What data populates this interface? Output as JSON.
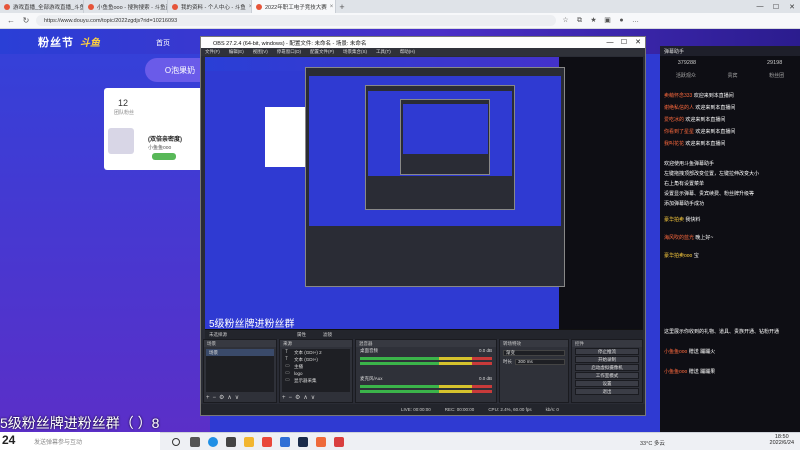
{
  "browser": {
    "tabs": [
      {
        "label": "游戏直播_全部游戏直播_斗鱼直..."
      },
      {
        "label": "小鱼鱼ooo - 搜狗搜索 - 斗鱼直..."
      },
      {
        "label": "我的资料 - 个人中心 - 斗鱼"
      },
      {
        "label": "2022年职工电子竞技大赛"
      }
    ],
    "url": "https://www.douyu.com/topic/2022zgdjs?rid=10216093",
    "new_tab": "+",
    "controls": {
      "min": "—",
      "max": "☐",
      "close": "✕"
    }
  },
  "douyu": {
    "logo": "粉丝节",
    "logo_badge": "斗鱼",
    "nav_home": "首页",
    "banner": "O泡果奶",
    "card": {
      "count": "12",
      "count_label": "团队粉丝",
      "name": "(双倍亲密度)",
      "account": "小鱼鱼ooo"
    }
  },
  "chat": {
    "header": "弹幕助手",
    "stats": [
      "379288",
      "",
      "29198"
    ],
    "tabs": [
      "活跃观众",
      "贵宾",
      "粉丝团"
    ],
    "lines": [
      {
        "user": "卖萌怀念333",
        "text": "欢迎来到本直播间"
      },
      {
        "user": "谢绝私信的人",
        "text": "欢迎来到本直播间"
      },
      {
        "user": "爱吃冰的",
        "text": "欢迎来到本直播间"
      },
      {
        "user": "你看到了星星",
        "text": "欢迎来到本直播间"
      },
      {
        "user": "我叫花花",
        "text": "欢迎来到本直播间"
      },
      {
        "user": "",
        "text": "欢迎使用斗鱼弹幕助手"
      },
      {
        "user": "",
        "text": "左键拖拽顶部改变位置，左键拉伸改变大小"
      },
      {
        "user": "",
        "text": "右上角有设置菜单"
      },
      {
        "user": "",
        "text": "设置显示弹幕、贵宾续费、粉丝牌升级等"
      },
      {
        "user": "",
        "text": "添加弹幕助手成功"
      },
      {
        "user": "豪华拍卖",
        "text": "我快料"
      },
      {
        "user": "海风吹的蓝光",
        "text": "晚上好~"
      },
      {
        "user": "豪华拍卖ooo",
        "text": "宝"
      },
      {
        "user": "",
        "text": "这里展示你收到的礼物、道具、贵族开通、钻粉开通"
      },
      {
        "user": "小鱼鱼ooo",
        "text": "赠送 蹦蹦火"
      },
      {
        "user": "小鱼鱼ooo",
        "text": "赠送 蹦蹦果"
      }
    ]
  },
  "obs": {
    "title": "OBS 27.2.4 (64-bit, windows) - 配置文件: 未命名 - 场景: 未命名",
    "menu": [
      "文件(F)",
      "编辑(E)",
      "视图(V)",
      "停靠窗口(D)",
      "配置文件(P)",
      "场景集合(S)",
      "工具(T)",
      "帮助(H)"
    ],
    "preview_text": "5级粉丝牌进粉丝群",
    "scene_label": "未选择源",
    "props_btn": "属性",
    "filter_btn": "滤镜",
    "docks": {
      "scenes": {
        "title": "场景",
        "items": [
          "场景"
        ]
      },
      "sources": {
        "title": "来源",
        "items": [
          {
            "icon": "T",
            "name": "文本 (GDI+) 2"
          },
          {
            "icon": "T",
            "name": "文本 (GDI+)"
          },
          {
            "icon": "▭",
            "name": "主播"
          },
          {
            "icon": "▭",
            "name": "logo"
          },
          {
            "icon": "▭",
            "name": "显示器采集"
          }
        ]
      },
      "mixer": {
        "title": "混音器",
        "rows": [
          {
            "name": "桌面音频",
            "db": "0.0 dB"
          },
          {
            "name": "麦克风/Aux",
            "db": "0.0 dB"
          }
        ]
      },
      "transitions": {
        "title": "转场特效",
        "type": "渐变",
        "duration_label": "时长",
        "duration": "300 ms"
      },
      "controls": {
        "title": "控件",
        "buttons": [
          "停止推流",
          "开始录制",
          "启动虚拟摄像机",
          "工作室模式",
          "设置",
          "退出"
        ]
      }
    },
    "status": {
      "live": "LIVE: 00:00:00",
      "rec": "REC: 00:00:00",
      "cpu": "CPU: 2.4%, 60.00 fps",
      "kbps": "kb/s: 0"
    }
  },
  "overlay": {
    "bigtext": "5级粉丝牌进粉丝群（    ）8"
  },
  "bottom": {
    "left_num": "24",
    "hint": "发送弹幕参与互动"
  },
  "taskbar": {
    "temp": "33°C 多云",
    "time": "18:50",
    "date": "2022/6/24"
  }
}
